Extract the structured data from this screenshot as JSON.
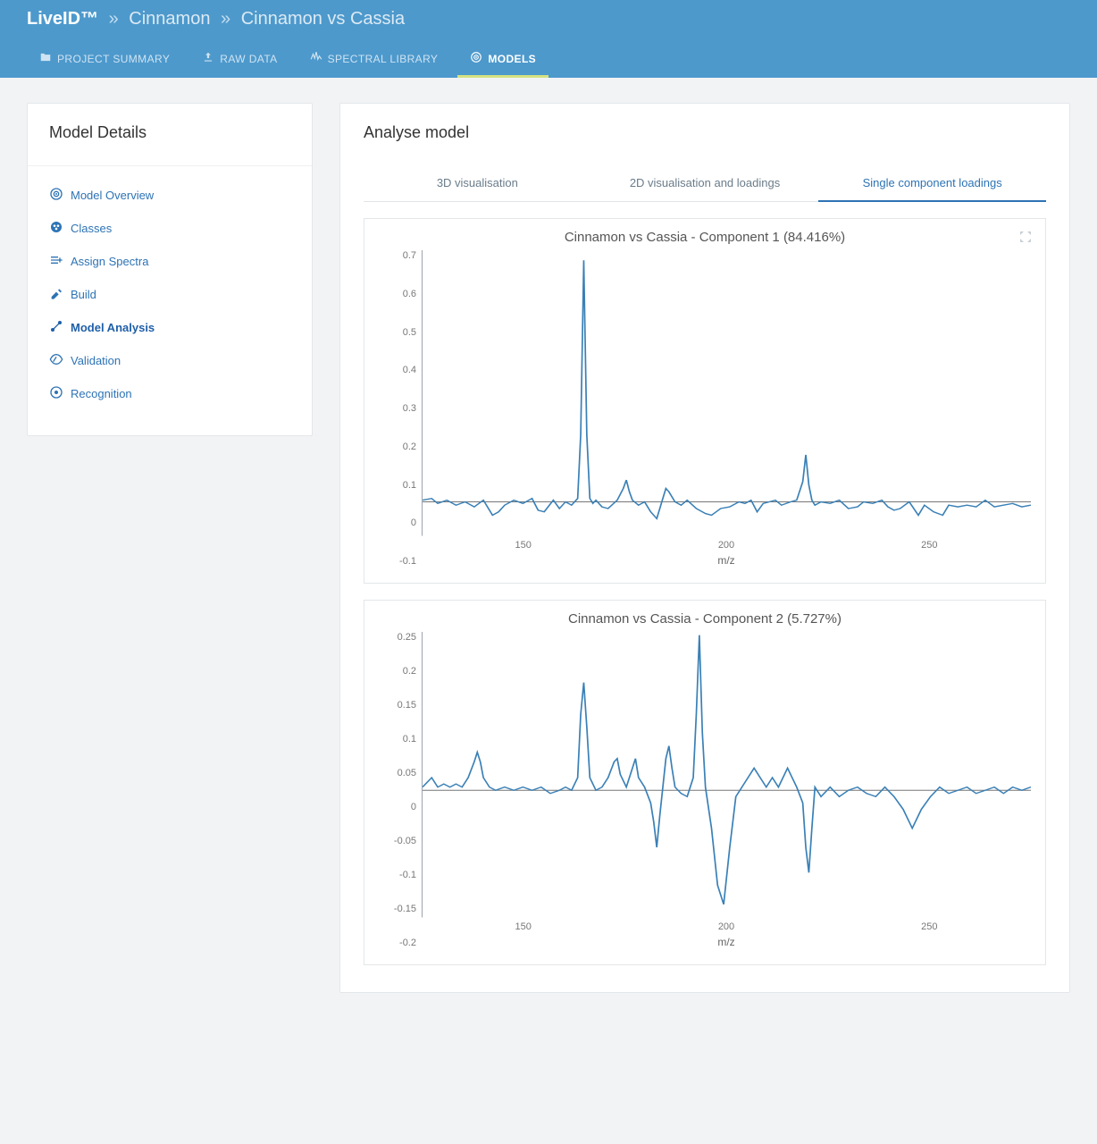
{
  "breadcrumb": {
    "app": "LiveID™",
    "parts": [
      "Cinnamon",
      "Cinnamon vs Cassia"
    ]
  },
  "topnav": {
    "items": [
      {
        "label": "PROJECT SUMMARY",
        "icon": "folder-icon"
      },
      {
        "label": "RAW DATA",
        "icon": "upload-icon"
      },
      {
        "label": "SPECTRAL LIBRARY",
        "icon": "wave-icon"
      },
      {
        "label": "MODELS",
        "icon": "target-icon"
      }
    ],
    "activeIndex": 3
  },
  "sidebar": {
    "title": "Model Details",
    "items": [
      {
        "label": "Model Overview",
        "icon": "target-icon"
      },
      {
        "label": "Classes",
        "icon": "classes-icon"
      },
      {
        "label": "Assign Spectra",
        "icon": "assign-icon"
      },
      {
        "label": "Build",
        "icon": "build-icon"
      },
      {
        "label": "Model Analysis",
        "icon": "analysis-icon"
      },
      {
        "label": "Validation",
        "icon": "validation-icon"
      },
      {
        "label": "Recognition",
        "icon": "recognition-icon"
      }
    ],
    "activeIndex": 4
  },
  "main": {
    "title": "Analyse model",
    "tabs": [
      "3D visualisation",
      "2D visualisation and loadings",
      "Single component loadings"
    ],
    "activeTab": 2
  },
  "chart_data": [
    {
      "type": "line",
      "title": "Cinnamon vs Cassia - Component 1 (84.416%)",
      "xlabel": "m/z",
      "ylabel": "",
      "xlim": [
        95,
        295
      ],
      "ylim": [
        -0.1,
        0.75
      ],
      "yticks": [
        -0.1,
        0,
        0.1,
        0.2,
        0.3,
        0.4,
        0.5,
        0.6,
        0.7
      ],
      "xticks": [
        150,
        200,
        250
      ],
      "line_color": "#3a80b6",
      "x": [
        95,
        98,
        100,
        103,
        106,
        109,
        112,
        115,
        118,
        120,
        122,
        125,
        128,
        131,
        133,
        135,
        138,
        140,
        142,
        144,
        146,
        147,
        148,
        149,
        150,
        151,
        152,
        154,
        156,
        159,
        161,
        162,
        163,
        164,
        166,
        168,
        170,
        172,
        174,
        175,
        176,
        178,
        180,
        182,
        185,
        188,
        190,
        193,
        196,
        199,
        201,
        203,
        205,
        207,
        209,
        211,
        213,
        216,
        218,
        220,
        221,
        222,
        223,
        224,
        226,
        229,
        232,
        235,
        238,
        240,
        243,
        246,
        248,
        250,
        252,
        255,
        258,
        260,
        263,
        266,
        268,
        271,
        274,
        277,
        280,
        283,
        286,
        289,
        292,
        295
      ],
      "y": [
        0.005,
        0.01,
        -0.005,
        0.005,
        -0.01,
        0.0,
        -0.015,
        0.005,
        -0.04,
        -0.03,
        -0.01,
        0.005,
        -0.005,
        0.01,
        -0.025,
        -0.03,
        0.005,
        -0.02,
        0.0,
        -0.01,
        0.01,
        0.2,
        0.72,
        0.2,
        0.01,
        -0.005,
        0.005,
        -0.015,
        -0.02,
        0.005,
        0.04,
        0.065,
        0.03,
        0.005,
        -0.01,
        0.0,
        -0.03,
        -0.05,
        0.01,
        0.04,
        0.03,
        0.0,
        -0.01,
        0.005,
        -0.02,
        -0.035,
        -0.04,
        -0.02,
        -0.015,
        0.0,
        -0.005,
        0.005,
        -0.03,
        -0.005,
        0.0,
        0.005,
        -0.01,
        0.0,
        0.005,
        0.06,
        0.14,
        0.05,
        0.005,
        -0.01,
        0.0,
        -0.005,
        0.005,
        -0.02,
        -0.015,
        0.0,
        -0.005,
        0.005,
        -0.015,
        -0.025,
        -0.02,
        0.0,
        -0.04,
        -0.01,
        -0.03,
        -0.04,
        -0.01,
        -0.015,
        -0.01,
        -0.015,
        0.005,
        -0.015,
        -0.01,
        -0.005,
        -0.015,
        -0.01
      ]
    },
    {
      "type": "line",
      "title": "Cinnamon vs Cassia - Component 2 (5.727%)",
      "xlabel": "m/z",
      "ylabel": "",
      "xlim": [
        95,
        295
      ],
      "ylim": [
        -0.2,
        0.25
      ],
      "yticks": [
        -0.2,
        -0.15,
        -0.1,
        -0.05,
        0,
        0.05,
        0.1,
        0.15,
        0.2,
        0.25
      ],
      "xticks": [
        150,
        200,
        250
      ],
      "line_color": "#3a80b6",
      "x": [
        95,
        98,
        100,
        102,
        104,
        106,
        108,
        110,
        112,
        113,
        114,
        115,
        117,
        119,
        122,
        125,
        128,
        131,
        134,
        137,
        140,
        142,
        144,
        146,
        147,
        148,
        149,
        150,
        152,
        154,
        156,
        158,
        159,
        160,
        162,
        164,
        165,
        166,
        168,
        170,
        171,
        172,
        173,
        175,
        176,
        177,
        178,
        180,
        182,
        184,
        185,
        186,
        187,
        188,
        190,
        192,
        194,
        196,
        198,
        200,
        202,
        204,
        206,
        208,
        210,
        212,
        215,
        218,
        220,
        221,
        222,
        223,
        224,
        226,
        229,
        232,
        235,
        238,
        241,
        244,
        247,
        250,
        253,
        256,
        259,
        262,
        265,
        268,
        271,
        274,
        277,
        280,
        283,
        286,
        289,
        292,
        295
      ],
      "y": [
        0.005,
        0.02,
        0.005,
        0.01,
        0.005,
        0.01,
        0.005,
        0.02,
        0.045,
        0.06,
        0.045,
        0.02,
        0.005,
        0.0,
        0.005,
        0.0,
        0.005,
        0.0,
        0.005,
        -0.005,
        0.0,
        0.005,
        0.0,
        0.02,
        0.12,
        0.17,
        0.1,
        0.02,
        0.0,
        0.005,
        0.02,
        0.045,
        0.05,
        0.025,
        0.005,
        0.035,
        0.05,
        0.02,
        0.005,
        -0.02,
        -0.05,
        -0.09,
        -0.04,
        0.05,
        0.07,
        0.035,
        0.005,
        -0.005,
        -0.01,
        0.02,
        0.12,
        0.245,
        0.09,
        0.005,
        -0.06,
        -0.15,
        -0.18,
        -0.09,
        -0.01,
        0.005,
        0.02,
        0.035,
        0.02,
        0.005,
        0.02,
        0.005,
        0.035,
        0.005,
        -0.02,
        -0.09,
        -0.13,
        -0.06,
        0.005,
        -0.01,
        0.005,
        -0.01,
        0.0,
        0.005,
        -0.005,
        -0.01,
        0.005,
        -0.01,
        -0.03,
        -0.06,
        -0.03,
        -0.01,
        0.005,
        -0.005,
        0.0,
        0.005,
        -0.005,
        0.0,
        0.005,
        -0.005,
        0.005,
        0.0,
        0.005
      ]
    }
  ]
}
